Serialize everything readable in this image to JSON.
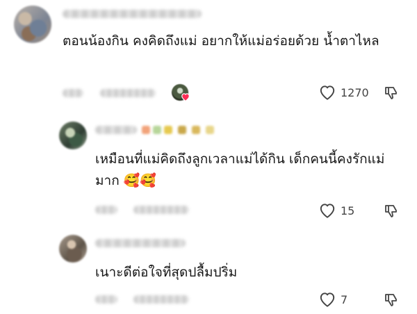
{
  "comments": [
    {
      "text": "ตอนน้องกิน คงคิดถึงแม่ อยากให้แม่อร่อยด้วย น้ำตาไหล",
      "likes": "1270",
      "creator_liked": true
    },
    {
      "text": "เหมือนที่แม่คิดถึงลูกเวลาแม่ได้กิน เด็กคนนี้คงรักแม่มาก 🥰🥰",
      "likes": "15"
    },
    {
      "text": "เนาะดีต่อใจที่สุดปลื้มปริ่ม",
      "likes": "7"
    }
  ],
  "icons": {
    "like": "heart-outline-icon",
    "dislike": "thumbs-down-outline-icon",
    "creator_like": "creator-heart-badge-icon"
  },
  "colors": {
    "text": "#161616",
    "icon": "#444444",
    "heart_badge": "#fe2c55"
  }
}
